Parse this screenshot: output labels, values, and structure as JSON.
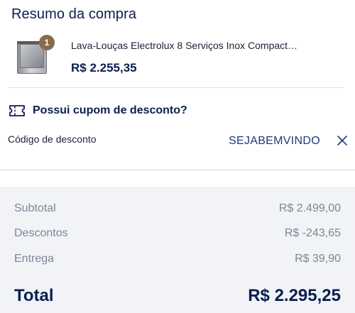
{
  "summary_title": "Resumo da compra",
  "product": {
    "quantity": "1",
    "name": "Lava-Louças Electrolux 8 Serviços Inox Compact…",
    "price": "R$ 2.255,35"
  },
  "coupon": {
    "question": "Possui cupom de desconto?",
    "label": "Código de desconto",
    "code": "SEJABEMVINDO"
  },
  "totals": {
    "subtotal_label": "Subtotal",
    "subtotal_value": "R$ 2.499,00",
    "discounts_label": "Descontos",
    "discounts_value": "R$ -243,65",
    "shipping_label": "Entrega",
    "shipping_value": "R$ 39,90",
    "total_label": "Total",
    "total_value": "R$ 2.295,25"
  },
  "colors": {
    "primary_text": "#0b1e4e",
    "muted_text": "#7d8597",
    "badge": "#8a6a4f",
    "summary_bg": "#f1f3f7"
  },
  "icons": {
    "ticket": "ticket-icon",
    "close": "close-icon"
  }
}
